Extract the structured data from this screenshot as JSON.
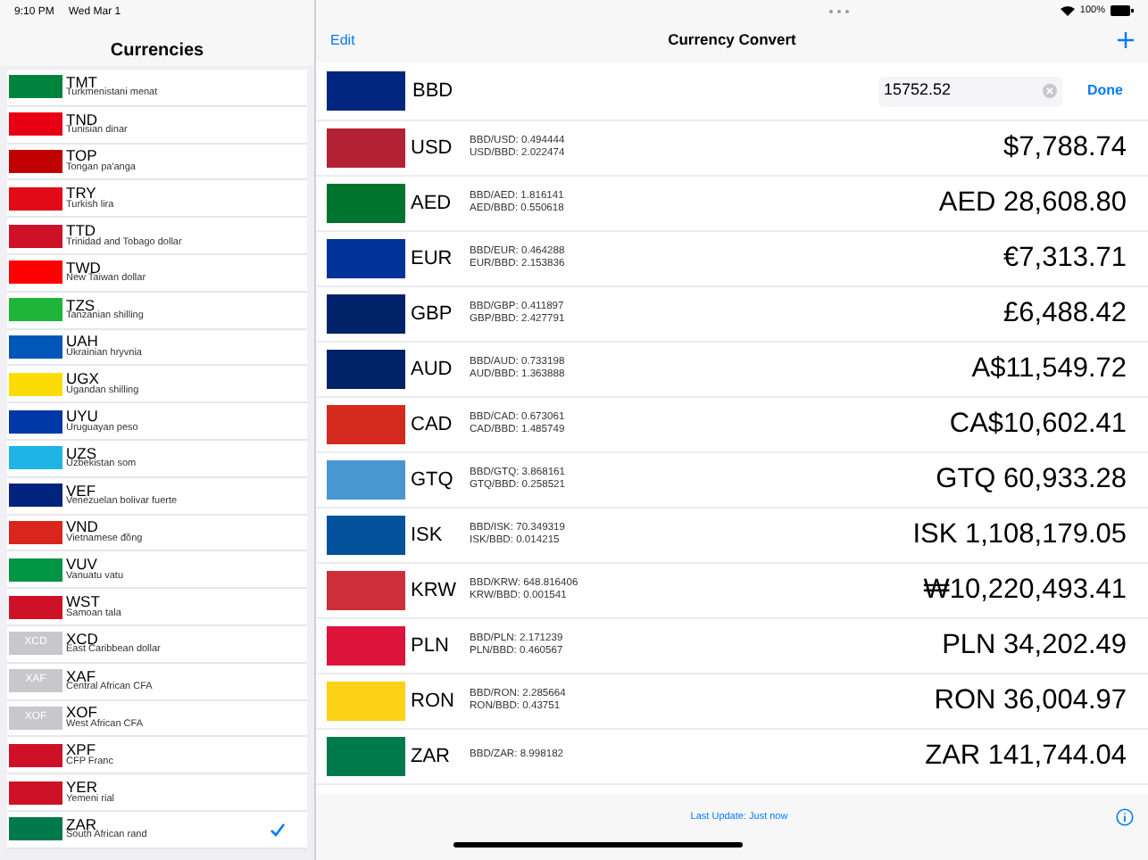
{
  "left_status": {
    "time": "9:10 PM",
    "date": "Wed Mar 1"
  },
  "sidebar": {
    "title": "Currencies",
    "items": [
      {
        "code": "TMT",
        "name": "Turkmenistani menat",
        "selected": false,
        "color": "#00843d"
      },
      {
        "code": "TND",
        "name": "Tunisian dinar",
        "selected": false,
        "color": "#e70013"
      },
      {
        "code": "TOP",
        "name": "Tongan pa'anga",
        "selected": false,
        "color": "#c10000"
      },
      {
        "code": "TRY",
        "name": "Turkish lira",
        "selected": false,
        "color": "#e30a17"
      },
      {
        "code": "TTD",
        "name": "Trinidad and Tobago dollar",
        "selected": false,
        "color": "#ce1126"
      },
      {
        "code": "TWD",
        "name": "New Taiwan dollar",
        "selected": false,
        "color": "#fe0000"
      },
      {
        "code": "TZS",
        "name": "Tanzanian shilling",
        "selected": false,
        "color": "#1eb53a"
      },
      {
        "code": "UAH",
        "name": "Ukrainian hryvnia",
        "selected": false,
        "color": "#0057b7"
      },
      {
        "code": "UGX",
        "name": "Ugandan shilling",
        "selected": false,
        "color": "#fcdc04"
      },
      {
        "code": "UYU",
        "name": "Uruguayan peso",
        "selected": false,
        "color": "#0038a8"
      },
      {
        "code": "UZS",
        "name": "Uzbekistan som",
        "selected": false,
        "color": "#1eb5e6"
      },
      {
        "code": "VEF",
        "name": "Venezuelan bolivar fuerte",
        "selected": false,
        "color": "#00247d"
      },
      {
        "code": "VND",
        "name": "Vietnamese đồng",
        "selected": false,
        "color": "#da251d"
      },
      {
        "code": "VUV",
        "name": "Vanuatu vatu",
        "selected": false,
        "color": "#009543"
      },
      {
        "code": "WST",
        "name": "Samoan tala",
        "selected": false,
        "color": "#ce1126"
      },
      {
        "code": "XCD",
        "name": "East Caribbean dollar",
        "selected": false,
        "color": "#c7c7cc",
        "flag_text": "XCD"
      },
      {
        "code": "XAF",
        "name": "Central African CFA",
        "selected": false,
        "color": "#c7c7cc",
        "flag_text": "XAF"
      },
      {
        "code": "XOF",
        "name": "West African CFA",
        "selected": false,
        "color": "#c7c7cc",
        "flag_text": "XOF"
      },
      {
        "code": "XPF",
        "name": "CFP Franc",
        "selected": false,
        "color": "#ce1126"
      },
      {
        "code": "YER",
        "name": "Yemeni rial",
        "selected": false,
        "color": "#ce1126"
      },
      {
        "code": "ZAR",
        "name": "South African rand",
        "selected": true,
        "color": "#007a4d"
      }
    ]
  },
  "right_status": {
    "battery": "100%"
  },
  "nav": {
    "edit": "Edit",
    "title": "Currency Convert"
  },
  "base": {
    "code": "BBD",
    "value": "15752.52",
    "done": "Done",
    "color": "#00267f"
  },
  "rows": [
    {
      "code": "USD",
      "rates": [
        "BBD/USD: 0.494444",
        "USD/BBD: 2.022474"
      ],
      "amount": "$7,788.74",
      "color": "#b22234"
    },
    {
      "code": "AED",
      "rates": [
        "BBD/AED: 1.816141",
        "AED/BBD: 0.550618"
      ],
      "amount": "AED 28,608.80",
      "color": "#00732f"
    },
    {
      "code": "EUR",
      "rates": [
        "BBD/EUR: 0.464288",
        "EUR/BBD: 2.153836"
      ],
      "amount": "€7,313.71",
      "color": "#003399"
    },
    {
      "code": "GBP",
      "rates": [
        "BBD/GBP: 0.411897",
        "GBP/BBD: 2.427791"
      ],
      "amount": "£6,488.42",
      "color": "#012169"
    },
    {
      "code": "AUD",
      "rates": [
        "BBD/AUD: 0.733198",
        "AUD/BBD: 1.363888"
      ],
      "amount": "A$11,549.72",
      "color": "#012169"
    },
    {
      "code": "CAD",
      "rates": [
        "BBD/CAD: 0.673061",
        "CAD/BBD: 1.485749"
      ],
      "amount": "CA$10,602.41",
      "color": "#d52b1e"
    },
    {
      "code": "GTQ",
      "rates": [
        "BBD/GTQ: 3.868161",
        "GTQ/BBD: 0.258521"
      ],
      "amount": "GTQ 60,933.28",
      "color": "#4997d0"
    },
    {
      "code": "ISK",
      "rates": [
        "BBD/ISK: 70.349319",
        "ISK/BBD: 0.014215"
      ],
      "amount": "ISK 1,108,179.05",
      "color": "#02529c"
    },
    {
      "code": "KRW",
      "rates": [
        "BBD/KRW: 648.816406",
        "KRW/BBD: 0.001541"
      ],
      "amount": "₩10,220,493.41",
      "color": "#cd2e3a"
    },
    {
      "code": "PLN",
      "rates": [
        "BBD/PLN: 2.171239",
        "PLN/BBD: 0.460567"
      ],
      "amount": "PLN 34,202.49",
      "color": "#dc143c"
    },
    {
      "code": "RON",
      "rates": [
        "BBD/RON: 2.285664",
        "RON/BBD: 0.43751"
      ],
      "amount": "RON 36,004.97",
      "color": "#fcd116"
    },
    {
      "code": "ZAR",
      "rates": [
        "BBD/ZAR: 8.998182"
      ],
      "amount": "ZAR 141,744.04",
      "color": "#007a4d"
    }
  ],
  "status_bar": {
    "text": "Last Update: Just now"
  }
}
